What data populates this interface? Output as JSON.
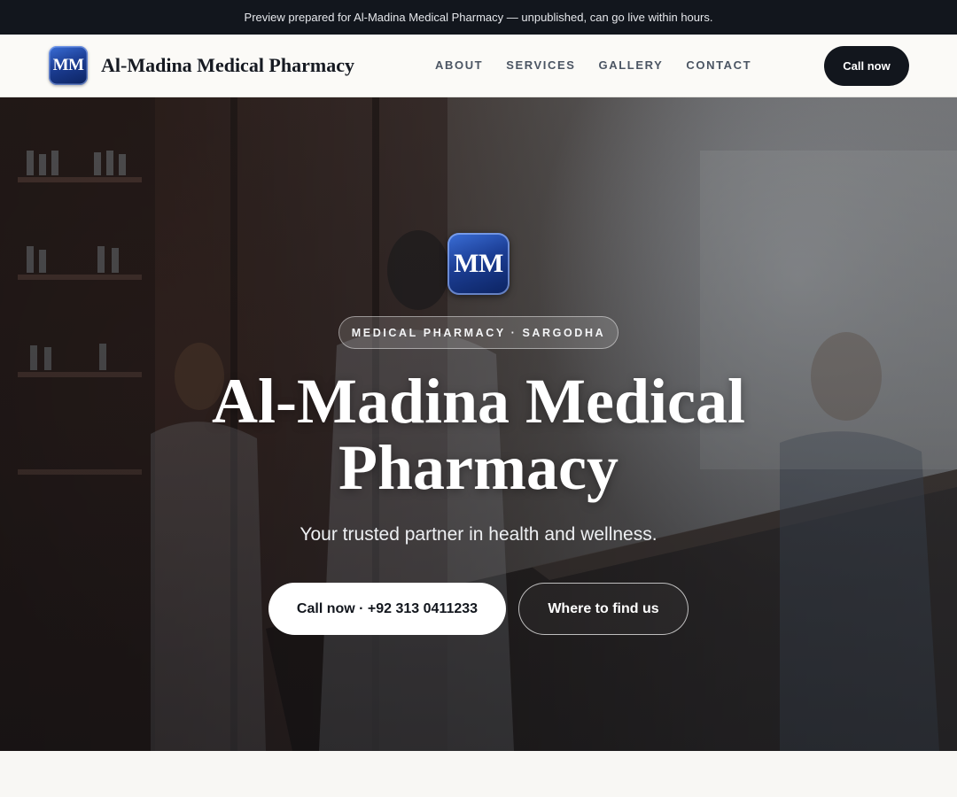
{
  "banner": {
    "text": "Preview prepared for Al-Madina Medical Pharmacy — unpublished, can go live within hours."
  },
  "header": {
    "logo_text": "MM",
    "brand_name": "Al-Madina Medical Pharmacy",
    "nav": [
      {
        "label": "ABOUT"
      },
      {
        "label": "SERVICES"
      },
      {
        "label": "GALLERY"
      },
      {
        "label": "CONTACT"
      }
    ],
    "cta_label": "Call now"
  },
  "hero": {
    "logo_text": "MM",
    "tag": "MEDICAL PHARMACY · SARGODHA",
    "title_line1": "Al-Madina Medical",
    "title_line2": "Pharmacy",
    "subtitle": "Your trusted partner in health and wellness.",
    "primary_button": "Call now · +92 313 0411233",
    "secondary_button": "Where to find us"
  },
  "colors": {
    "banner_bg": "#12161d",
    "logo_blue": "#1c3e95",
    "page_bg": "#f8f7f4",
    "cta_bg": "#12161d"
  },
  "icons": [
    "mm-logo-icon"
  ]
}
